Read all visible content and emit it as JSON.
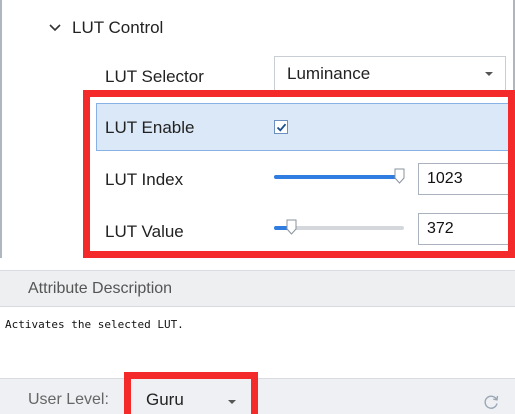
{
  "group": {
    "title": "LUT Control",
    "expanded": true
  },
  "rows": {
    "selector": {
      "label": "LUT Selector",
      "value": "Luminance"
    },
    "enable": {
      "label": "LUT Enable",
      "checked": true
    },
    "index": {
      "label": "LUT Index",
      "value": "1023",
      "slider_fraction": 0.96
    },
    "value": {
      "label": "LUT Value",
      "value": "372",
      "slider_fraction": 0.13
    }
  },
  "description": {
    "header": "Attribute Description",
    "text": "Activates the selected LUT."
  },
  "footer": {
    "user_level_label": "User Level:",
    "user_level_value": "Guru"
  },
  "icons": {
    "group_toggle": "chevron-down-icon",
    "checkbox": "checkmark-icon",
    "refresh": "refresh-icon"
  },
  "colors": {
    "highlight": "#f42a2a",
    "selected_row": "#dbe8f8",
    "slider_fill": "#2f7de1"
  }
}
